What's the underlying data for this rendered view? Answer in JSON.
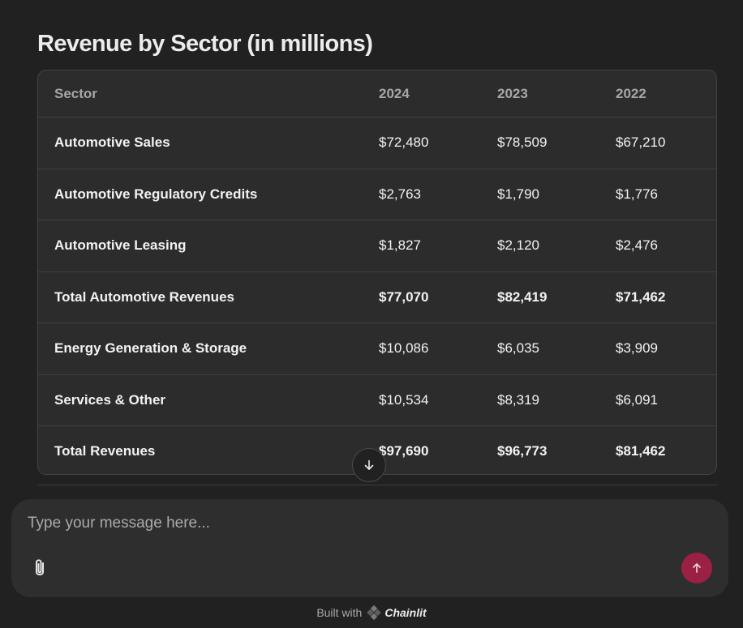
{
  "title": "Revenue by Sector (in millions)",
  "table": {
    "headers": [
      "Sector",
      "2024",
      "2023",
      "2022"
    ],
    "rows": [
      [
        "Automotive Sales",
        "$72,480",
        "$78,509",
        "$67,210"
      ],
      [
        "Automotive Regulatory Credits",
        "$2,763",
        "$1,790",
        "$1,776"
      ],
      [
        "Automotive Leasing",
        "$1,827",
        "$2,120",
        "$2,476"
      ],
      [
        "Total Automotive Revenues",
        "$77,070",
        "$82,419",
        "$71,462"
      ],
      [
        "Energy Generation & Storage",
        "$10,086",
        "$6,035",
        "$3,909"
      ],
      [
        "Services & Other",
        "$10,534",
        "$8,319",
        "$6,091"
      ],
      [
        "Total Revenues",
        "$97,690",
        "$96,773",
        "$81,462"
      ]
    ]
  },
  "composer": {
    "placeholder": "Type your message here...",
    "value": ""
  },
  "footer": {
    "built_with": "Built with",
    "brand": "Chainlit"
  },
  "icons": {
    "scroll": "arrow-down-icon",
    "attach": "paperclip-icon",
    "send": "arrow-up-icon",
    "brand": "chainlit-logo-icon"
  },
  "colors": {
    "background": "#212121",
    "table_bg": "#2c2c2c",
    "composer_bg": "#2e2e2e",
    "send_button": "#9a2143"
  }
}
